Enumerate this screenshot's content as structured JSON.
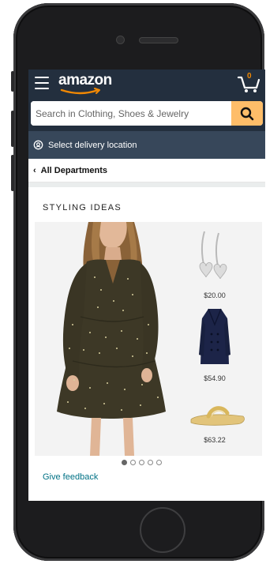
{
  "header": {
    "logo_text": "amazon",
    "cart_count": "0",
    "menu_icon": "hamburger-icon",
    "cart_icon": "cart-icon"
  },
  "search": {
    "placeholder": "Search in Clothing, Shoes & Jewelry",
    "icon": "search-icon"
  },
  "delivery": {
    "label": "Select delivery location",
    "icon": "location-pin-icon"
  },
  "departments": {
    "chevron": "‹",
    "label": "All Departments"
  },
  "styling": {
    "title": "STYLING IDEAS",
    "items": [
      {
        "name": "earrings",
        "price": "$20.00"
      },
      {
        "name": "coat",
        "price": "$54.90"
      },
      {
        "name": "sandals",
        "price": "$63.22"
      }
    ],
    "carousel": {
      "count": 5,
      "active": 0
    }
  },
  "feedback": {
    "label": "Give feedback"
  },
  "colors": {
    "nav_dark": "#232f3e",
    "nav_secondary": "#37475a",
    "search_button": "#febd69",
    "cart_count": "#f08804",
    "link": "#007185"
  }
}
